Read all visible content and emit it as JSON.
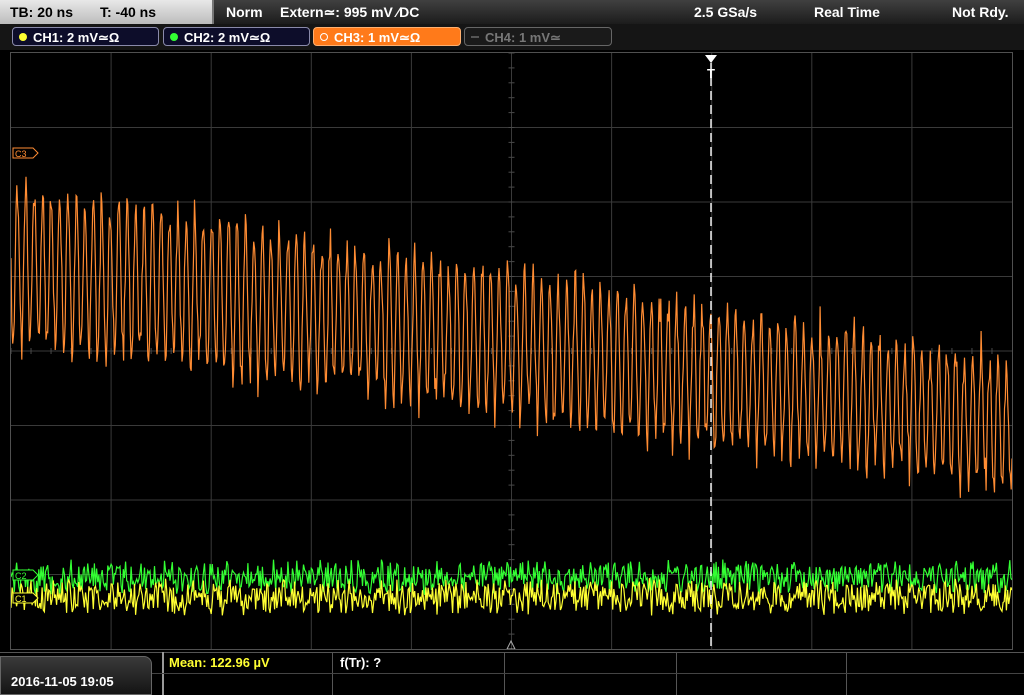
{
  "status": {
    "timebase": "TB: 20 ns",
    "trigger_offset": "T: -40 ns",
    "trigger_mode": "Norm",
    "trigger_source": "Extern≃: 995 mV ∕DC",
    "sample_rate": "2.5 GSa/s",
    "acq_mode": "Real Time",
    "ready_state": "Not Rdy."
  },
  "channels": [
    {
      "label": "CH1: 2 mV≃Ω",
      "color": "#ffff33",
      "active": true
    },
    {
      "label": "CH2: 2 mV≃Ω",
      "color": "#33ff33",
      "active": true
    },
    {
      "label": "CH3: 1 mV≃Ω",
      "color": "#ff8c33",
      "active": true,
      "selected": true
    },
    {
      "label": "CH4: 1 mV≃",
      "color": "#777777",
      "active": false
    }
  ],
  "markers": {
    "ch3": "C3",
    "ch2": "C2",
    "ch1": "C1",
    "trigger": "T"
  },
  "footer": {
    "datetime": "2016-11-05 19:05",
    "mean": "Mean: 122.96 µV",
    "freq": "f(Tr): ?"
  },
  "colors": {
    "ch1": "#ffff33",
    "ch2": "#33ff33",
    "ch3": "#ff8c33",
    "grid": "#3a3a3a",
    "trigger_line": "#ffffff"
  }
}
